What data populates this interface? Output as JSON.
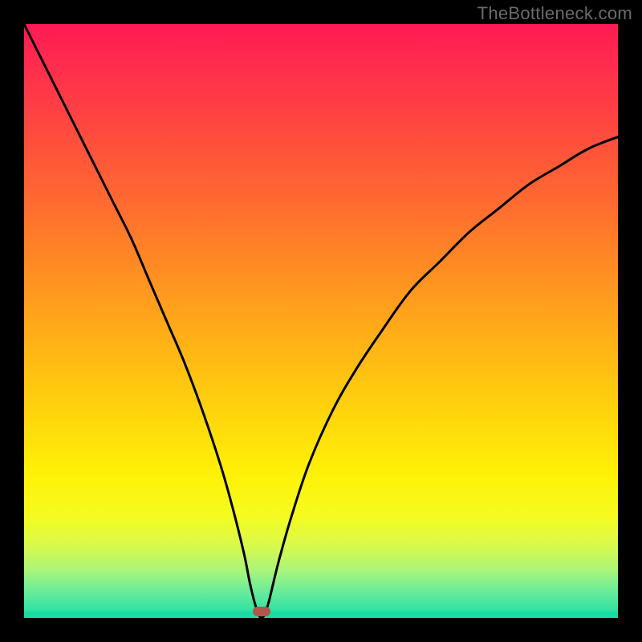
{
  "watermark": "TheBottleneck.com",
  "colors": {
    "frame_bg": "#000000",
    "curve": "#000000",
    "marker": "#b2564c",
    "gradient_top": "#ff1a54",
    "gradient_bottom": "#18dfa2"
  },
  "chart_data": {
    "type": "line",
    "title": "",
    "xlabel": "",
    "ylabel": "",
    "xlim": [
      0,
      100
    ],
    "ylim": [
      0,
      100
    ],
    "grid": false,
    "legend": false,
    "marker_x": 40,
    "marker_y": 0,
    "series": [
      {
        "name": "bottleneck-curve",
        "x": [
          0,
          3,
          6,
          9,
          12,
          15,
          18,
          21,
          24,
          27,
          30,
          33,
          35,
          37,
          38,
          39,
          40,
          41,
          42,
          43,
          45,
          48,
          52,
          56,
          60,
          65,
          70,
          75,
          80,
          85,
          90,
          95,
          100
        ],
        "values": [
          100,
          94,
          88,
          82,
          76,
          70,
          64,
          57,
          50,
          43,
          35,
          26,
          19,
          11,
          6,
          2,
          0,
          2,
          6,
          10,
          17,
          26,
          35,
          42,
          48,
          55,
          60,
          65,
          69,
          73,
          76,
          79,
          81
        ]
      }
    ]
  }
}
